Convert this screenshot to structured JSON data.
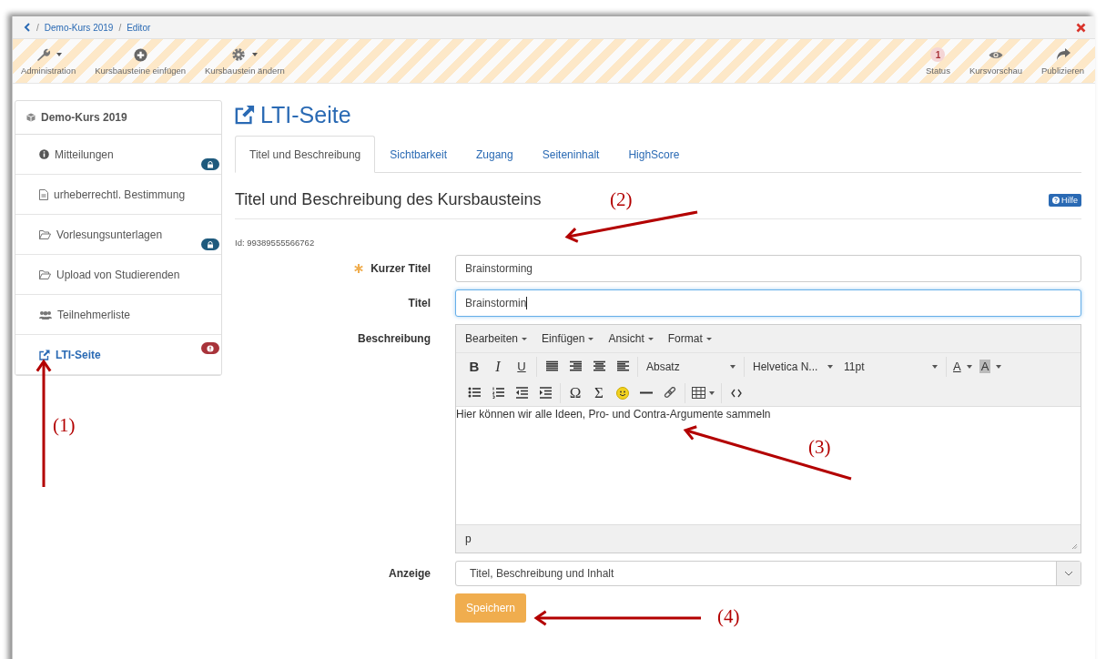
{
  "breadcrumb": {
    "separator": "/",
    "items": [
      "Demo-Kurs 2019",
      "Editor"
    ]
  },
  "toolbar": {
    "left": [
      {
        "kind": "wrench",
        "label": "Administration",
        "dropdown": true
      },
      {
        "kind": "plus",
        "label": "Kursbausteine einfügen",
        "dropdown": false
      },
      {
        "kind": "gear",
        "label": "Kursbaustein ändern",
        "dropdown": true
      }
    ],
    "right": [
      {
        "kind": "status",
        "count": "1",
        "label": "Status"
      },
      {
        "kind": "eye",
        "label": "Kursvorschau"
      },
      {
        "kind": "share",
        "label": "Publizieren"
      }
    ]
  },
  "sidebar": {
    "root": "Demo-Kurs 2019",
    "items": [
      {
        "kind": "info",
        "label": "Mitteilungen",
        "locked": true,
        "warning": false,
        "selected": false
      },
      {
        "kind": "file",
        "label": "urheberrechtl. Bestimmung",
        "locked": false,
        "warning": false,
        "selected": false
      },
      {
        "kind": "folder",
        "label": "Vorlesungsunterlagen",
        "locked": true,
        "warning": false,
        "selected": false
      },
      {
        "kind": "folder",
        "label": "Upload von Studierenden",
        "locked": false,
        "warning": false,
        "selected": false
      },
      {
        "kind": "users",
        "label": "Teilnehmerliste",
        "locked": false,
        "warning": false,
        "selected": false
      },
      {
        "kind": "external",
        "label": "LTI-Seite",
        "locked": false,
        "warning": true,
        "selected": true
      }
    ]
  },
  "page_title": "LTI-Seite",
  "tabs": [
    {
      "label": "Titel und Beschreibung",
      "selected": true
    },
    {
      "label": "Sichtbarkeit",
      "selected": false
    },
    {
      "label": "Zugang",
      "selected": false
    },
    {
      "label": "Seiteninhalt",
      "selected": false
    },
    {
      "label": "HighScore",
      "selected": false
    }
  ],
  "section": {
    "heading": "Titel und Beschreibung des Kursbausteins",
    "help": "Hilfe",
    "id": "Id: 99389555566762"
  },
  "fields": [
    {
      "label": "Kurzer Titel",
      "required": true,
      "value": "Brainstorming",
      "focused": false
    },
    {
      "label": "Titel",
      "required": false,
      "value": "Brainstormin",
      "focused": true
    }
  ],
  "editor": {
    "label": "Beschreibung",
    "menus": [
      "Bearbeiten",
      "Einfügen",
      "Ansicht",
      "Format"
    ],
    "rows": [
      [
        [
          {
            "kind": "bold",
            "label": "B"
          },
          {
            "kind": "italic",
            "label": "I"
          },
          {
            "kind": "underline",
            "label": "U"
          }
        ],
        [
          {
            "kind": "justify"
          },
          {
            "kind": "right"
          },
          {
            "kind": "center"
          },
          {
            "kind": "left"
          }
        ],
        [
          {
            "kind": "select",
            "label": "Absatz"
          }
        ],
        [
          {
            "kind": "select",
            "label": "Helvetica N..."
          },
          {
            "kind": "select",
            "label": "11pt"
          }
        ],
        [
          {
            "kind": "color",
            "label": "A"
          },
          {
            "kind": "background",
            "label": "A"
          }
        ]
      ],
      [
        [
          {
            "kind": "bullist"
          },
          {
            "kind": "numlist"
          },
          {
            "kind": "outdent"
          },
          {
            "kind": "indent"
          }
        ],
        [
          {
            "kind": "glyph",
            "label": "Ω"
          },
          {
            "kind": "glyph",
            "label": "Σ"
          },
          {
            "kind": "smiley"
          },
          {
            "kind": "hr"
          },
          {
            "kind": "link"
          }
        ],
        [
          {
            "kind": "table"
          }
        ],
        [
          {
            "kind": "code"
          }
        ]
      ]
    ],
    "content": "Hier können wir alle Ideen, Pro- und Contra-Argumente sammeln",
    "path": "p"
  },
  "display": {
    "label": "Anzeige",
    "value": "Titel, Beschreibung und Inhalt"
  },
  "save": "Speichern",
  "annotations": [
    "(1)",
    "(2)",
    "(3)",
    "(4)"
  ]
}
